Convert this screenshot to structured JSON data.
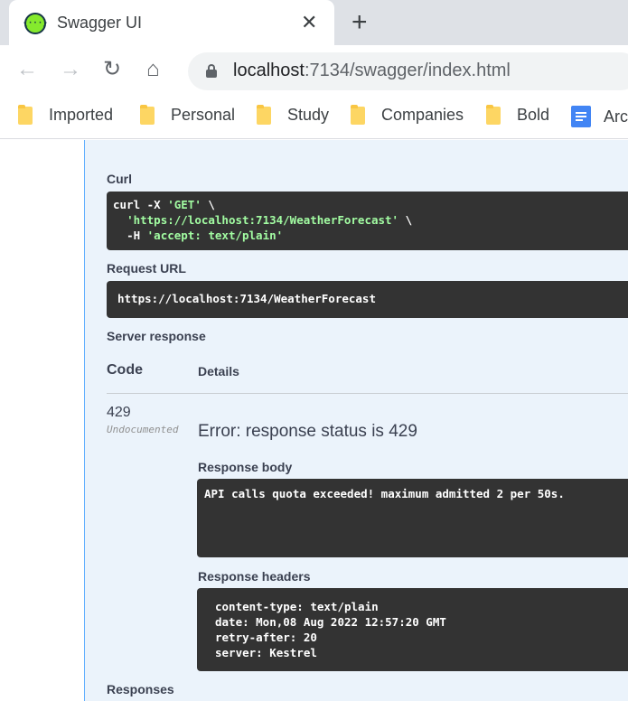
{
  "browser": {
    "tab_title": "Swagger UI",
    "tab_favicon_glyph": "{···}",
    "tab_close": "✕",
    "new_tab": "+",
    "url_host": "localhost",
    "url_rest": ":7134/swagger/index.html",
    "nav": {
      "back": "←",
      "forward": "→",
      "reload": "↻",
      "home": "⌂"
    },
    "bookmarks": [
      "Imported",
      "Personal",
      "Study",
      "Companies",
      "Bold",
      "Arc"
    ]
  },
  "swagger": {
    "curl_label": "Curl",
    "curl_line1_cmd": "curl -X ",
    "curl_line1_method": "'GET'",
    "curl_line1_tail": " \\",
    "curl_line2_url": "'https://localhost:7134/WeatherForecast'",
    "curl_line2_tail": " \\",
    "curl_line3_flag": "-H ",
    "curl_line3_header": "'accept: text/plain'",
    "request_url_label": "Request URL",
    "request_url": "https://localhost:7134/WeatherForecast",
    "server_response_label": "Server response",
    "col_code": "Code",
    "col_details": "Details",
    "response": {
      "code": "429",
      "undocumented": "Undocumented",
      "error": "Error: response status is 429",
      "body_label": "Response body",
      "body": "API calls quota exceeded! maximum admitted 2 per 50s.",
      "headers_label": "Response headers",
      "headers": [
        "content-type: text/plain",
        "date: Mon,08 Aug 2022 12:57:20 GMT",
        "retry-after: 20",
        "server: Kestrel"
      ]
    },
    "responses_label": "Responses"
  },
  "colors": {
    "panel_bg": "#ebf3fb",
    "panel_border": "#61affe",
    "code_bg": "#333333",
    "string_token": "#a2fca2"
  }
}
